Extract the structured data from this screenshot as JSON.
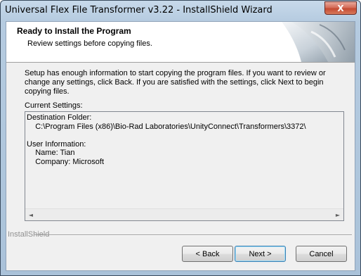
{
  "window": {
    "title": "Universal Flex File Transformer v3.22 - InstallShield Wizard",
    "close_glyph": "X"
  },
  "header": {
    "title": "Ready to Install the Program",
    "subtitle": "Review settings before copying files."
  },
  "body": {
    "description": "Setup has enough information to start copying the program files.  If you want to review or change any settings, click Back.  If you are satisfied with the settings, click Next to begin copying files.",
    "current_settings_label": "Current Settings:",
    "settings_text": "Destination Folder:\n    C:\\Program Files (x86)\\Bio-Rad Laboratories\\UnityConnect\\Transformers\\3372\\\n\nUser Information:\n    Name: Tian\n    Company: Microsoft"
  },
  "footer": {
    "brand": "InstallShield",
    "back_label": "< Back",
    "next_label": "Next >",
    "cancel_label": "Cancel"
  },
  "icons": {
    "scroll_left": "◄",
    "scroll_right": "►"
  }
}
